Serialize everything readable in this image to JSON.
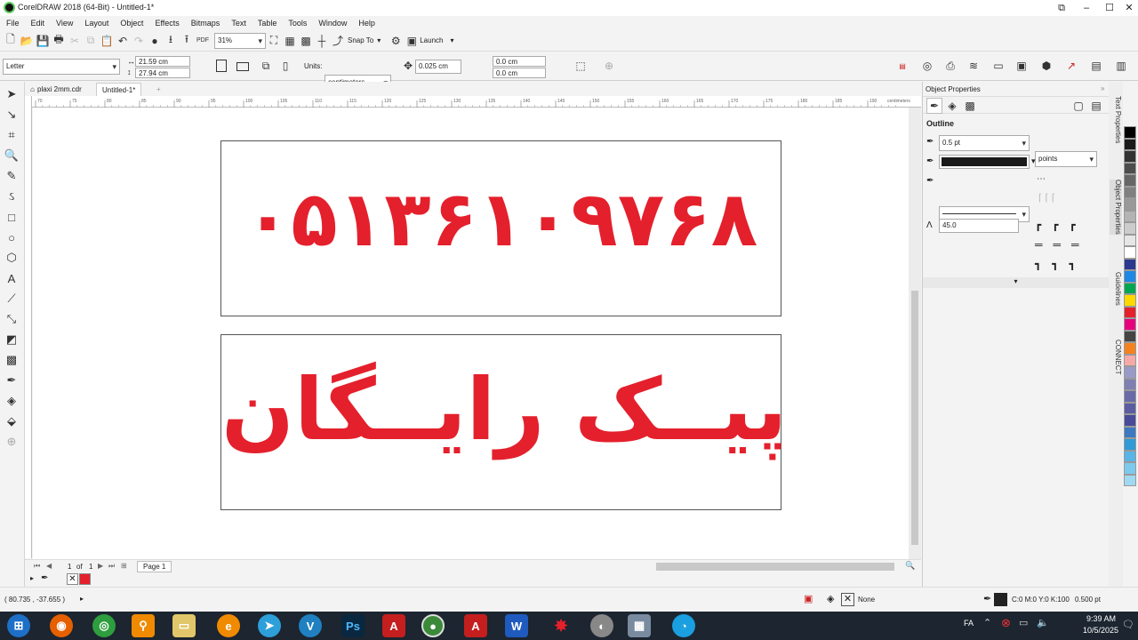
{
  "window": {
    "title": "CorelDRAW 2018 (64-Bit) - Untitled-1*"
  },
  "menu": [
    "File",
    "Edit",
    "View",
    "Layout",
    "Object",
    "Effects",
    "Bitmaps",
    "Text",
    "Table",
    "Tools",
    "Window",
    "Help"
  ],
  "toolbar": {
    "zoom": "31%",
    "snap_to": "Snap To",
    "launch": "Launch"
  },
  "property_bar": {
    "page_size": "Letter",
    "width": "21.59 cm",
    "height": "27.94 cm",
    "units_label": "Units:",
    "units": "centimeters",
    "nudge": "0.025 cm",
    "dup_x": "0.0 cm",
    "dup_y": "0.0 cm"
  },
  "doc_tabs": [
    "plaxi 2mm.cdr",
    "Untitled-1*"
  ],
  "ruler_ticks": [
    "70",
    "75",
    "80",
    "85",
    "90",
    "95",
    "100",
    "105",
    "110",
    "115",
    "120",
    "125",
    "130",
    "135",
    "140",
    "145",
    "150",
    "155",
    "160",
    "165",
    "170",
    "175",
    "180",
    "185",
    "190"
  ],
  "ruler_unit": "centimeters",
  "boards": [
    {
      "text": "۰۵۱۳۶۱۰۹۷۶۸"
    },
    {
      "text": "پیــک رایــگان"
    }
  ],
  "page_nav": {
    "current": "1",
    "of": "of",
    "total": "1",
    "page_tab": "Page 1"
  },
  "status": {
    "coords": "( 80.735 , -37.655 )",
    "fill_label": "None",
    "outline_color": "C:0 M:0 Y:0 K:100",
    "outline_width": "0.500 pt"
  },
  "panel": {
    "title": "Object Properties",
    "section": "Outline",
    "width": "0.5 pt",
    "units": "points",
    "miter": "45.0"
  },
  "side_tabs": [
    "Text Properties",
    "Object Properties",
    "Guidelines",
    "CONNECT"
  ],
  "palette_colors": [
    "#000000",
    "#1a1a1a",
    "#333333",
    "#4d4d4d",
    "#666666",
    "#808080",
    "#999999",
    "#b3b3b3",
    "#cccccc",
    "#e6e6e6",
    "#ffffff",
    "#2b3a8f",
    "#1e88e5",
    "#00a651",
    "#ffd800",
    "#e4202c",
    "#e6007e",
    "#444444",
    "#f58220",
    "#f7a9a8",
    "#9a9ac7",
    "#7f7fb2",
    "#6a6aa8",
    "#5c5ca0",
    "#4a4a98",
    "#3d78c0",
    "#2f9ad6",
    "#5ab4e5",
    "#7dc9ee",
    "#a0d9f2"
  ],
  "taskbar": {
    "lang": "FA",
    "time": "9:39 AM",
    "date": "10/5/2025"
  }
}
